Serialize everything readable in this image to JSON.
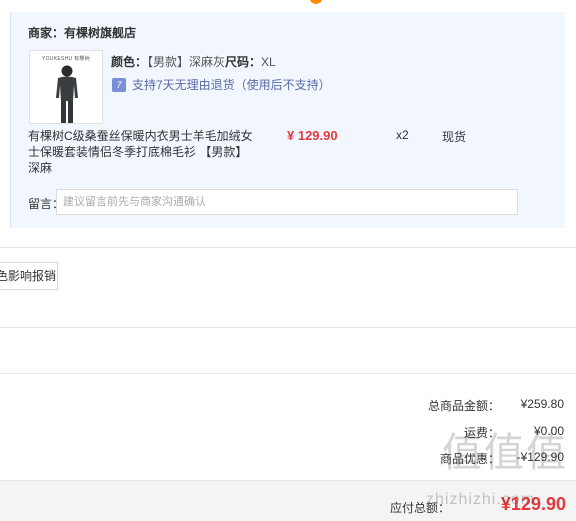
{
  "merchant": {
    "label": "商家：",
    "name": "有棵树旗舰店"
  },
  "item": {
    "thumb_brand": "YOUKESHU 有棵树",
    "spec_color_label": "颜色：",
    "spec_color_value": "【男款】深麻灰",
    "spec_size_label": "尺码：",
    "spec_size_value": "XL",
    "return_icon": "7",
    "return_text": "支持7天无理由退货（使用后不支持）",
    "title": "有棵树C级桑蚕丝保暖内衣男士羊毛加绒女士保暖套装情侣冬季打底棉毛衫 【男款】深麻",
    "price": "¥ 129.90",
    "quantity": "x2",
    "stock": "现货"
  },
  "remark": {
    "label": "留言：",
    "placeholder": "建议留言前先与商家沟通确认"
  },
  "report_button": "色影响报销",
  "summary": {
    "goods_total_label": "总商品金额：",
    "goods_total_value": "¥259.80",
    "shipping_label": "运费：",
    "shipping_value": "¥0.00",
    "discount_label": "商品优惠：",
    "discount_value": "-¥129.90"
  },
  "footer": {
    "payable_label": "应付总额：",
    "payable_value": "¥129.90"
  },
  "watermark": {
    "text": "值值值",
    "sub": "zhizhizhi.com"
  },
  "colors": {
    "price_red": "#e4393c",
    "card_bg": "#f2f7ff",
    "accent_orange": "#ff8a00"
  }
}
